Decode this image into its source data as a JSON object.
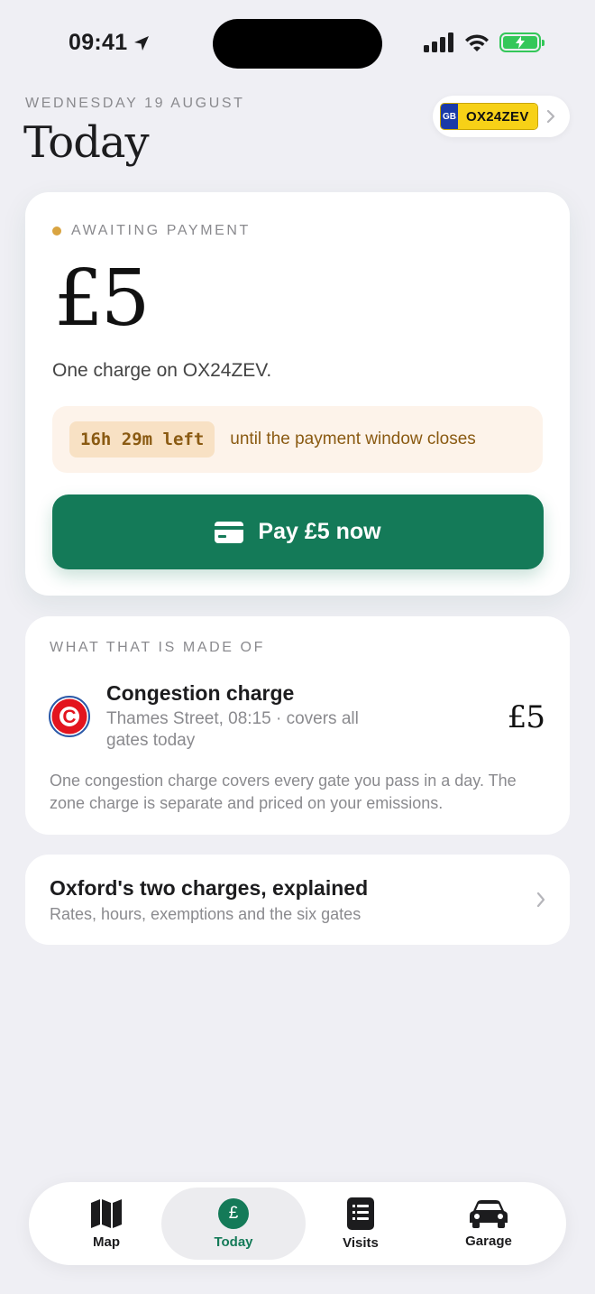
{
  "status_bar": {
    "time": "09:41"
  },
  "header": {
    "date": "WEDNESDAY 19 AUGUST",
    "title": "Today",
    "plate": {
      "country": "GB",
      "registration": "OX24ZEV"
    }
  },
  "payment": {
    "status": "AWAITING PAYMENT",
    "amount": "£5",
    "description": "One charge on OX24ZEV.",
    "countdown": "16h 29m left",
    "countdown_note": "until the payment window closes",
    "button_label": "Pay £5 now"
  },
  "breakdown": {
    "label": "WHAT THAT IS MADE OF",
    "item": {
      "title": "Congestion charge",
      "subtitle": "Thames Street, 08:15 · covers all gates today",
      "amount": "£5",
      "logo_letter": "C"
    },
    "note": "One congestion charge covers every gate you pass in a day. The zone charge is separate and priced on your emissions."
  },
  "explainer": {
    "title": "Oxford's two charges, explained",
    "subtitle": "Rates, hours, exemptions and the six gates"
  },
  "tabs": [
    {
      "label": "Map",
      "icon": "map-icon"
    },
    {
      "label": "Today",
      "icon": "pound-icon",
      "active": true
    },
    {
      "label": "Visits",
      "icon": "list-icon"
    },
    {
      "label": "Garage",
      "icon": "car-icon"
    }
  ],
  "colors": {
    "accent": "#147a58",
    "awaiting": "#d9a441",
    "timer_bg": "#fdf3ea",
    "timer_text": "#8a5a12",
    "background": "#efeff4"
  }
}
